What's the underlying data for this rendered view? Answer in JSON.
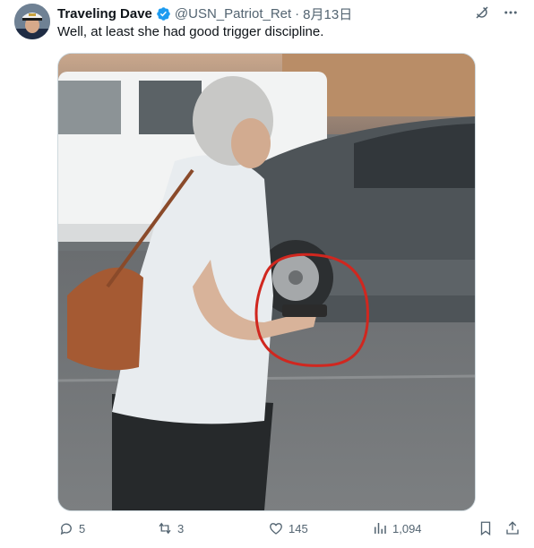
{
  "tweet": {
    "display_name": "Traveling Dave",
    "handle": "@USN_Patriot_Ret",
    "separator": "·",
    "date": "8月13日",
    "text": "Well, at least she had good trigger discipline.",
    "verified": true,
    "avatar_icon": "avatar-sailor-cap",
    "media_description_hidden": true
  },
  "actions": {
    "replies": "5",
    "reposts": "3",
    "likes": "145",
    "views": "1,094"
  },
  "icons": {
    "grok": "grok-icon",
    "more": "more-icon",
    "reply": "reply-icon",
    "repost": "repost-icon",
    "like": "like-icon",
    "views": "views-icon",
    "bookmark": "bookmark-icon",
    "share": "share-icon"
  },
  "colors": {
    "text": "#0f1419",
    "secondary": "#536471",
    "verified": "#1d9bf0",
    "circle_annotation": "#d0271f"
  }
}
